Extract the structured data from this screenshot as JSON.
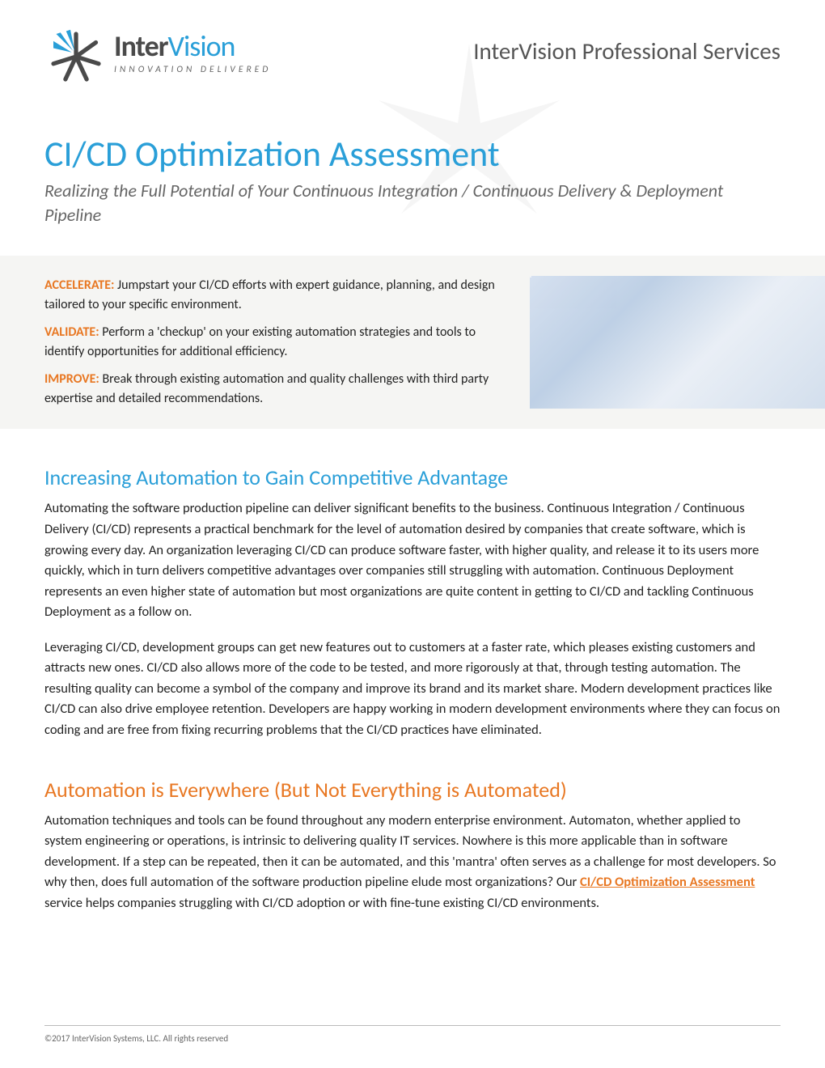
{
  "logo": {
    "name_a": "Inter",
    "name_b": "Vision",
    "tagline": "INNOVATION DELIVERED"
  },
  "header_right": "InterVision Professional Services",
  "title": "CI/CD Optimization Assessment",
  "subtitle": "Realizing the Full Potential of Your Continuous Integration / Continuous Delivery & Deployment Pipeline",
  "highlights": {
    "accelerate": {
      "key": "ACCELERATE:",
      "text": " Jumpstart your CI/CD efforts with expert guidance, planning, and design tailored to your specific environment."
    },
    "validate": {
      "key": "VALIDATE:",
      "text": " Perform a 'checkup' on your existing automation strategies and tools to identify opportunities for additional efficiency."
    },
    "improve": {
      "key": "IMPROVE:",
      "text": "  Break through existing automation and quality challenges with third party expertise and detailed recommendations."
    }
  },
  "section1_h": "Increasing Automation to Gain Competitive Advantage",
  "section1_p1": "Automating the software production pipeline can deliver significant benefits to the business.  Continuous Integration / Continuous Delivery (CI/CD) represents a practical benchmark for the level of automation desired by companies that create software, which is growing every day.  An organization leveraging CI/CD can produce software faster, with higher quality, and release it to its users more quickly, which in turn delivers competitive advantages over companies still struggling with automation.  Continuous Deployment represents an even higher state of automation but most organizations are quite content in getting to CI/CD and tackling Continuous Deployment as a follow on.",
  "section1_p2": "Leveraging CI/CD, development groups can get new features out to customers at a faster rate, which pleases existing customers and attracts new ones.  CI/CD also allows more of the code to be tested, and more rigorously at that, through testing automation.  The resulting quality can become a symbol of the company and improve its brand and its market share.  Modern development practices like CI/CD can also drive employee retention.  Developers are happy working in modern development environments where they can focus on coding and are free from fixing recurring problems that the CI/CD practices have eliminated.",
  "section2_h": "Automation is Everywhere (But Not Everything is Automated)",
  "section2_p1a": "Automation techniques and tools can be found throughout any modern enterprise environment. Automaton, whether applied to system engineering or operations, is intrinsic to delivering quality IT services.  Nowhere is this more applicable than in software development.  If a step can be repeated, then it can be automated, and this 'mantra' often serves as a challenge for most developers. So why then, does full automation of the software production pipeline elude most organizations?  Our ",
  "section2_link": "CI/CD Optimization Assessment",
  "section2_p1b": " service helps companies struggling with CI/CD adoption or with fine-tune existing CI/CD environments.",
  "footer": "©2017 InterVision Systems, LLC. All rights reserved"
}
